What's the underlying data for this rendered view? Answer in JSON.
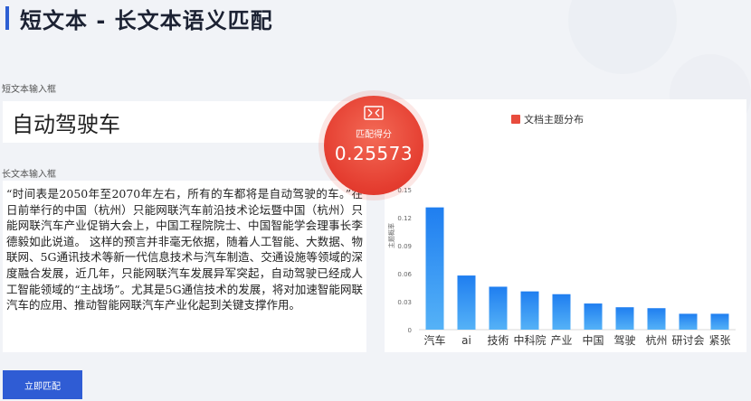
{
  "page": {
    "title": "短文本 - 长文本语义匹配"
  },
  "short_input": {
    "label": "短文本输入框",
    "value": "自动驾驶车"
  },
  "long_input": {
    "label": "长文本输入框",
    "value": "“时间表是2050年至2070年左右，所有的车都将是自动驾驶的车。”在日前举行的中国（杭州）只能网联汽车前沿技术论坛暨中国（杭州）只能网联汽车产业促销大会上，中国工程院院士、中国智能学会理事长李德毅如此说道。 这样的预言并非毫无依据，随着人工智能、大数据、物联网、5G通讯技术等新一代信息技术与汽车制造、交通设施等领域的深度融合发展，近几年，只能网联汽车发展异军突起，自动驾驶已经成人工智能领域的“主战场”。尤其是5G通信技术的发展，将对加速智能网联汽车的应用、推动智能网联汽车产业化起到关键支撑作用。"
  },
  "score": {
    "label": "匹配得分",
    "value": "0.25573",
    "icon": "score-badge-icon"
  },
  "actions": {
    "match_label": "立即匹配"
  },
  "colors": {
    "accent": "#2f5cd4",
    "score_bg": "#e43c2f",
    "bar": "#2f8cf0"
  },
  "chart_data": {
    "type": "bar",
    "title": "文档主题分布",
    "ylabel": "主题概率",
    "categories": [
      "汽车",
      "ai",
      "技術",
      "中科院",
      "产业",
      "中国",
      "驾驶",
      "杭州",
      "研讨会",
      "紧张"
    ],
    "values": [
      0.131,
      0.058,
      0.046,
      0.041,
      0.038,
      0.028,
      0.024,
      0.023,
      0.017,
      0.017
    ],
    "yticks": [
      "0",
      "0.03",
      "0.06",
      "0.09",
      "0.12",
      "0.15"
    ],
    "ylim": [
      0,
      0.15
    ]
  }
}
